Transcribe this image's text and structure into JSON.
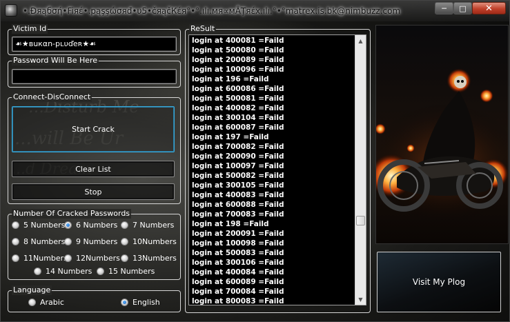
{
  "window": {
    "title": "•.Ðяąбσή•Fiяέ•.pąşşώσяđ•υ5•čяąčКέя°•°.ılı.мя∝мÅŢяέx.ılı.°•°matrex.is.bk@nimbuzz.com",
    "minimize_label": "─",
    "maximize_label": "□",
    "close_label": "✕"
  },
  "victim": {
    "group_label": "Victim Id",
    "value": "☙★вuкαn-pʟυďeʀ★☙"
  },
  "password": {
    "group_label": "Password Will Be Here",
    "value": ""
  },
  "connect": {
    "group_label": "Connect-DisConnect",
    "start_label": "Start Crack",
    "clear_label": "Clear List",
    "stop_label": "Stop"
  },
  "cracked": {
    "group_label": "Number Of Cracked Passwords",
    "options": [
      {
        "label": "5 Numbers",
        "checked": false
      },
      {
        "label": "6 Numbers",
        "checked": true
      },
      {
        "label": "7 Numbers",
        "checked": false
      },
      {
        "label": "8 Numbers",
        "checked": false
      },
      {
        "label": "9  Numbers",
        "checked": false
      },
      {
        "label": "10Numbers",
        "checked": false
      },
      {
        "label": "11Numbers",
        "checked": false
      },
      {
        "label": "12Numbers",
        "checked": false
      },
      {
        "label": "13Numbers",
        "checked": false
      },
      {
        "label": "14 Numbers",
        "checked": false
      },
      {
        "label": "15 Numbers",
        "checked": false
      }
    ]
  },
  "language": {
    "group_label": "Language",
    "options": [
      {
        "label": "Arabic",
        "checked": false
      },
      {
        "label": "English",
        "checked": true
      }
    ]
  },
  "result": {
    "group_label": "ReSult",
    "items": [
      "login at 400081 =Faild",
      "login at 500080 =Faild",
      "login at 200089 =Faild",
      "login at 100096 =Faild",
      "login at 196 =Faild",
      "login at 600086 =Faild",
      "login at 500081 =Faild",
      "login at 400082 =Faild",
      "login at 300104 =Faild",
      "login at 600087 =Faild",
      "login at 197 =Faild",
      "login at 700082 =Faild",
      "login at 200090 =Faild",
      "login at 100097 =Faild",
      "login at 500082 =Faild",
      "login at 300105 =Faild",
      "login at 400083 =Faild",
      "login at 600088 =Faild",
      "login at 700083 =Faild",
      "login at 198 =Faild",
      "login at 200091 =Faild",
      "login at 100098 =Faild",
      "login at 500083 =Faild",
      "login at 300106 =Faild",
      "login at 400084 =Faild",
      "login at 600089 =Faild",
      "login at 700084 =Faild",
      "login at 800083 =Faild"
    ],
    "scroll_up_label": "▲",
    "scroll_down_label": "▼"
  },
  "plog": {
    "label": "Visit My Plog"
  },
  "colors": {
    "accent_border": "#39a8d8",
    "close_button": "#c0402a",
    "radio_selected": "#1a5ab8"
  }
}
